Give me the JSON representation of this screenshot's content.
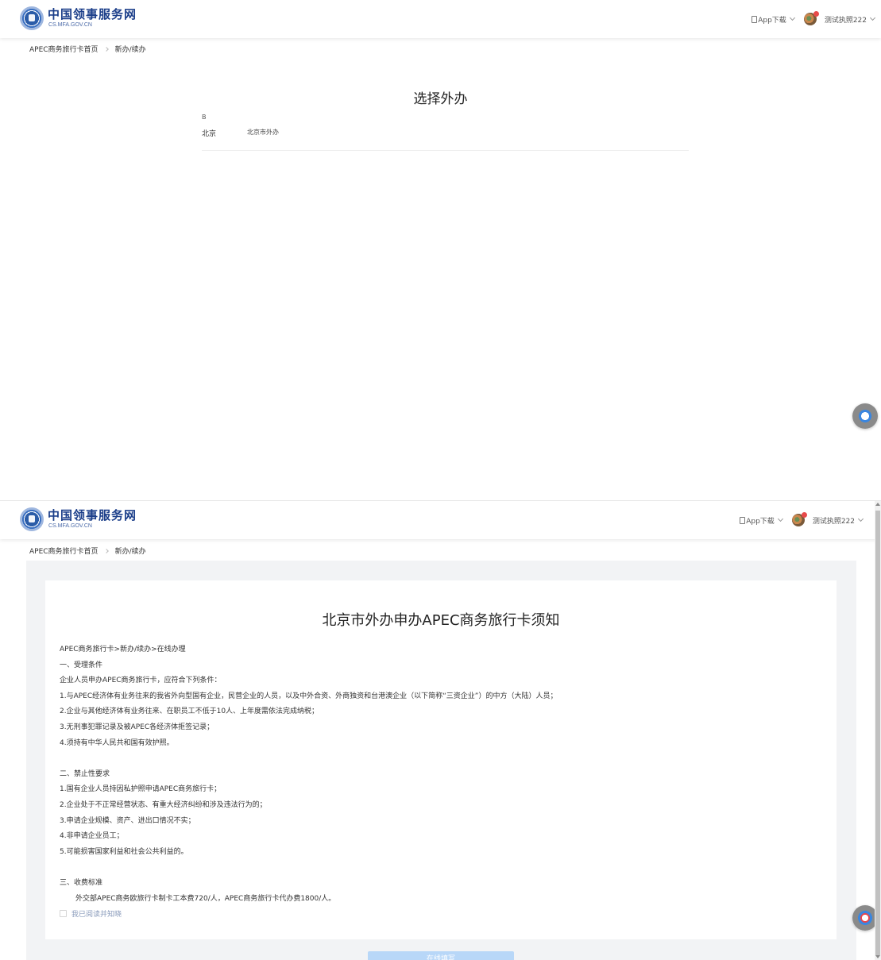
{
  "header": {
    "logo_cn": "中国领事服务网",
    "logo_en": "CS.MFA.GOV.CN",
    "app_download": "App下载",
    "user_name": "测试执照222"
  },
  "breadcrumb": {
    "home": "APEC商务旅行卡首页",
    "current": "新办/续办"
  },
  "select_page": {
    "title": "选择外办",
    "letter_group": "B",
    "offices": [
      {
        "city": "北京",
        "name": "北京市外办"
      }
    ]
  },
  "notice_page": {
    "title": "北京市外办申办APEC商务旅行卡须知",
    "lines": [
      "APEC商务旅行卡>新办/续办>在线办理",
      "一、受理条件",
      "企业人员申办APEC商务旅行卡，应符合下列条件：",
      "1.与APEC经济体有业务往来的我省外向型国有企业，民营企业的人员，以及中外合资、外商独资和台港澳企业（以下简称“三资企业”）的中方（大陆）人员；",
      "2.企业与其他经济体有业务往来、在职员工不低于10人、上年度需依法完成纳税；",
      "3.无刑事犯罪记录及被APEC各经济体拒签记录；",
      "4.须持有中华人民共和国有效护照。",
      "",
      "二、禁止性要求",
      "1.国有企业人员持因私护照申请APEC商务旅行卡；",
      "2.企业处于不正常经营状态、有重大经济纠纷和涉及违法行为的；",
      "3.申请企业规模、资产、进出口情况不实；",
      "4.非申请企业员工；",
      "5.可能损害国家利益和社会公共利益的。",
      "",
      "三、收费标准"
    ],
    "fee_line": "外交部APEC商务欧旅行卡制卡工本费720/人，APEC商务旅行卡代办费1800/人。",
    "agree_label": "我已阅读并知晓",
    "online_button": "在线填写"
  },
  "colors": {
    "brand_blue": "#1c3f8a",
    "button_disabled": "#b8d7f8",
    "gray_background": "#f2f3f5"
  }
}
